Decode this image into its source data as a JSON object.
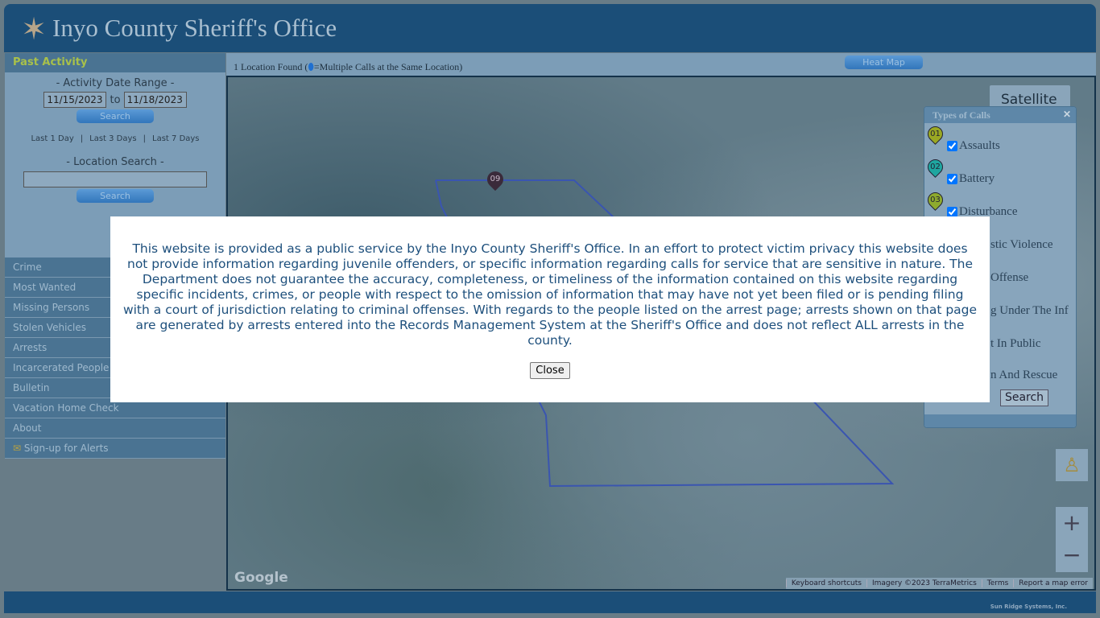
{
  "header": {
    "title": "Inyo County Sheriff's Office",
    "logo_icon": "sheriff-star-badge"
  },
  "sidebar": {
    "section": "Past Activity",
    "date_range_label": "- Activity Date Range -",
    "date_from": "11/15/2023",
    "to": "to",
    "date_to": "11/18/2023",
    "search_label": "Search",
    "quick": [
      "Last 1 Day",
      "|",
      "Last 3 Days",
      "|",
      "Last 7 Days"
    ],
    "location_label": "- Location Search -",
    "location_value": "",
    "location_search_label": "Search",
    "nav": [
      "Crime",
      "Most Wanted",
      "Missing Persons",
      "Stolen Vehicles",
      "Arrests",
      "Incarcerated People",
      "Bulletin",
      "Vacation Home Check",
      "About",
      "Sign-up for Alerts"
    ]
  },
  "toolbar": {
    "found_prefix": "1 Location Found (",
    "found_suffix": "=Multiple Calls at the Same Location)",
    "heat_map": "Heat Map"
  },
  "map": {
    "type_label": "Satellite",
    "marker": "09",
    "google": "Google",
    "attribution": [
      "Keyboard shortcuts",
      "Imagery ©2023 TerraMetrics",
      "Terms",
      "Report a map error"
    ],
    "zoom_in": "+",
    "zoom_out": "−"
  },
  "types_of_calls": {
    "title": "Types of Calls",
    "close": "✕",
    "search": "Search",
    "items": [
      {
        "code": "01",
        "label": "Assaults",
        "color": "#9aa823",
        "checked": true
      },
      {
        "code": "02",
        "label": "Battery",
        "color": "#1fa6a0",
        "checked": true
      },
      {
        "code": "03",
        "label": "Disturbance",
        "color": "#8eaa2e",
        "checked": true
      },
      {
        "label": "stic Violence"
      },
      {
        "label": "Offense"
      },
      {
        "label": "g Under The Inf"
      },
      {
        "label": "t In Public"
      },
      {
        "label": "n And Rescue"
      }
    ]
  },
  "modal": {
    "text": "This website is provided as a public service by the Inyo County Sheriff's Office. In an effort to protect victim privacy this website does not provide information regarding juvenile offenders, or specific information regarding calls for service that are sensitive in nature. The Department does not guarantee the accuracy, completeness, or timeliness of the information contained on this website regarding specific incidents, crimes, or people with respect to the omission of information that may have not yet been filed or is pending filing with a court of jurisdiction relating to criminal offenses. With regards to the people listed on the arrest page; arrests shown on that page are generated by arrests entered into the Records Management System at the Sheriff's Office and does not reflect ALL arrests in the county.",
    "close": "Close"
  },
  "footer": {
    "vendor": "Sun Ridge Systems, Inc."
  }
}
